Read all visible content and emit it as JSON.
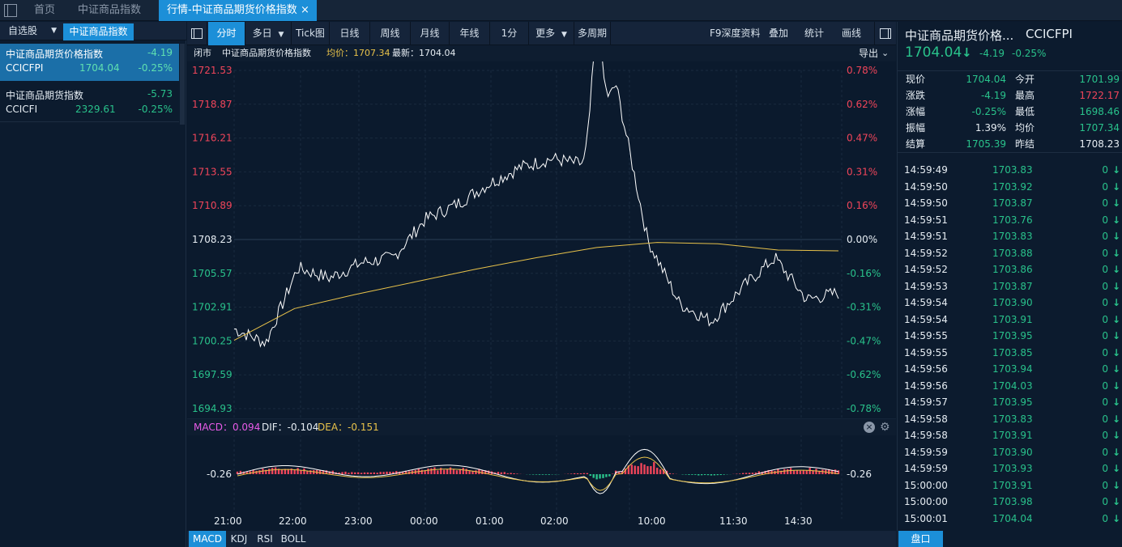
{
  "tabs": {
    "home": "首页",
    "index": "中证商品指数",
    "active": "行情-中证商品期货价格指数",
    "close": "×"
  },
  "left": {
    "tab_watch": "自选股",
    "tab_index": "中证商品指数",
    "items": [
      {
        "name": "中证商品期货价格指数",
        "code": "CCICFPI",
        "change": "-4.19",
        "price": "1704.04",
        "pct": "-0.25%"
      },
      {
        "name": "中证商品期货指数",
        "code": "CCICFI",
        "change": "-5.73",
        "price": "2329.61",
        "pct": "-0.25%"
      }
    ]
  },
  "toolbar": {
    "buttons": [
      "分时",
      "多日",
      "Tick图",
      "日线",
      "周线",
      "月线",
      "年线",
      "1分",
      "更多",
      "多周期"
    ],
    "right": [
      "F9深度资料",
      "叠加",
      "统计",
      "画线"
    ]
  },
  "infobar": {
    "status": "闭市",
    "name": "中证商品期货价格指数",
    "avg_label": "均价：1707.34",
    "last_label": "最新：1704.04",
    "export": "导出"
  },
  "price_axis": {
    "left": [
      "1721.53",
      "1718.87",
      "1716.21",
      "1713.55",
      "1710.89",
      "1708.23",
      "1705.57",
      "1702.91",
      "1700.25",
      "1697.59",
      "1694.93"
    ],
    "right": [
      "0.78%",
      "0.62%",
      "0.47%",
      "0.31%",
      "0.16%",
      "0.00%",
      "-0.16%",
      "-0.31%",
      "-0.47%",
      "-0.62%",
      "-0.78%"
    ]
  },
  "macd": {
    "label": "MACD：0.094",
    "dif": "DIF：-0.104",
    "dea": "DEA：-0.151",
    "axis_left": "-0.26",
    "axis_right": "-0.26"
  },
  "time_axis": [
    "21:00",
    "22:00",
    "23:00",
    "00:00",
    "01:00",
    "02:00",
    "10:00",
    "11:30",
    "14:30"
  ],
  "bottom_tabs": [
    "MACD",
    "KDJ",
    "RSI",
    "BOLL"
  ],
  "right": {
    "title": "中证商品期货价格...",
    "code": "CCICFPI",
    "price": "1704.04",
    "arrow": "↓",
    "change": "-4.19",
    "pct": "-0.25%",
    "quote": [
      {
        "l1": "现价",
        "v1": "1704.04",
        "l2": "今开",
        "v2": "1701.99"
      },
      {
        "l1": "涨跌",
        "v1": "-4.19",
        "l2": "最高",
        "v2": "1722.17"
      },
      {
        "l1": "涨幅",
        "v1": "-0.25%",
        "l2": "最低",
        "v2": "1698.46"
      },
      {
        "l1": "振幅",
        "v1": "1.39%",
        "l2": "均价",
        "v2": "1707.34"
      },
      {
        "l1": "结算",
        "v1": "1705.39",
        "l2": "昨结",
        "v2": "1708.23"
      }
    ],
    "ticks": [
      {
        "t": "14:59:49",
        "p": "1703.83",
        "v": "0"
      },
      {
        "t": "14:59:50",
        "p": "1703.92",
        "v": "0"
      },
      {
        "t": "14:59:50",
        "p": "1703.87",
        "v": "0"
      },
      {
        "t": "14:59:51",
        "p": "1703.76",
        "v": "0"
      },
      {
        "t": "14:59:51",
        "p": "1703.83",
        "v": "0"
      },
      {
        "t": "14:59:52",
        "p": "1703.88",
        "v": "0"
      },
      {
        "t": "14:59:52",
        "p": "1703.86",
        "v": "0"
      },
      {
        "t": "14:59:53",
        "p": "1703.87",
        "v": "0"
      },
      {
        "t": "14:59:54",
        "p": "1703.90",
        "v": "0"
      },
      {
        "t": "14:59:54",
        "p": "1703.91",
        "v": "0"
      },
      {
        "t": "14:59:55",
        "p": "1703.95",
        "v": "0"
      },
      {
        "t": "14:59:55",
        "p": "1703.85",
        "v": "0"
      },
      {
        "t": "14:59:56",
        "p": "1703.94",
        "v": "0"
      },
      {
        "t": "14:59:56",
        "p": "1704.03",
        "v": "0"
      },
      {
        "t": "14:59:57",
        "p": "1703.95",
        "v": "0"
      },
      {
        "t": "14:59:58",
        "p": "1703.83",
        "v": "0"
      },
      {
        "t": "14:59:58",
        "p": "1703.91",
        "v": "0"
      },
      {
        "t": "14:59:59",
        "p": "1703.90",
        "v": "0"
      },
      {
        "t": "14:59:59",
        "p": "1703.93",
        "v": "0"
      },
      {
        "t": "15:00:00",
        "p": "1703.91",
        "v": "0"
      },
      {
        "t": "15:00:00",
        "p": "1703.98",
        "v": "0"
      },
      {
        "t": "15:00:01",
        "p": "1704.04",
        "v": "0"
      }
    ],
    "bottom_btn": "盘口"
  },
  "colors": {
    "up": "#f0455a",
    "down": "#29c28b",
    "accent": "#1c8fd8",
    "avg": "#e8c24a",
    "price": "#ffffff"
  },
  "chart_data": {
    "type": "line",
    "series": [
      {
        "name": "最新",
        "x": [
          "21:00",
          "21:30",
          "22:00",
          "22:30",
          "23:00",
          "23:30",
          "00:00",
          "00:30",
          "01:00",
          "01:30",
          "02:00",
          "02:30",
          "09:30",
          "10:00",
          "10:30",
          "11:00",
          "13:30",
          "14:00",
          "14:30",
          "15:00"
        ],
        "values": [
          1701.2,
          1700.1,
          1706.0,
          1705.2,
          1706.4,
          1706.8,
          1709.8,
          1711.0,
          1712.6,
          1713.9,
          1714.6,
          1714.1,
          1720.5,
          1708.2,
          1703.2,
          1701.8,
          1704.5,
          1706.8,
          1703.5,
          1704.04
        ]
      },
      {
        "name": "均价",
        "x": [
          "21:00",
          "22:00",
          "23:00",
          "00:00",
          "01:00",
          "02:00",
          "09:30",
          "10:00",
          "11:00",
          "14:30",
          "15:00"
        ],
        "values": [
          1700.3,
          1702.8,
          1703.9,
          1704.9,
          1705.9,
          1706.8,
          1707.6,
          1708.0,
          1707.9,
          1707.4,
          1707.34
        ]
      }
    ],
    "ylim": [
      1694.93,
      1721.53
    ],
    "macd": {
      "dif": -0.104,
      "dea": -0.151,
      "macd": 0.094
    }
  }
}
